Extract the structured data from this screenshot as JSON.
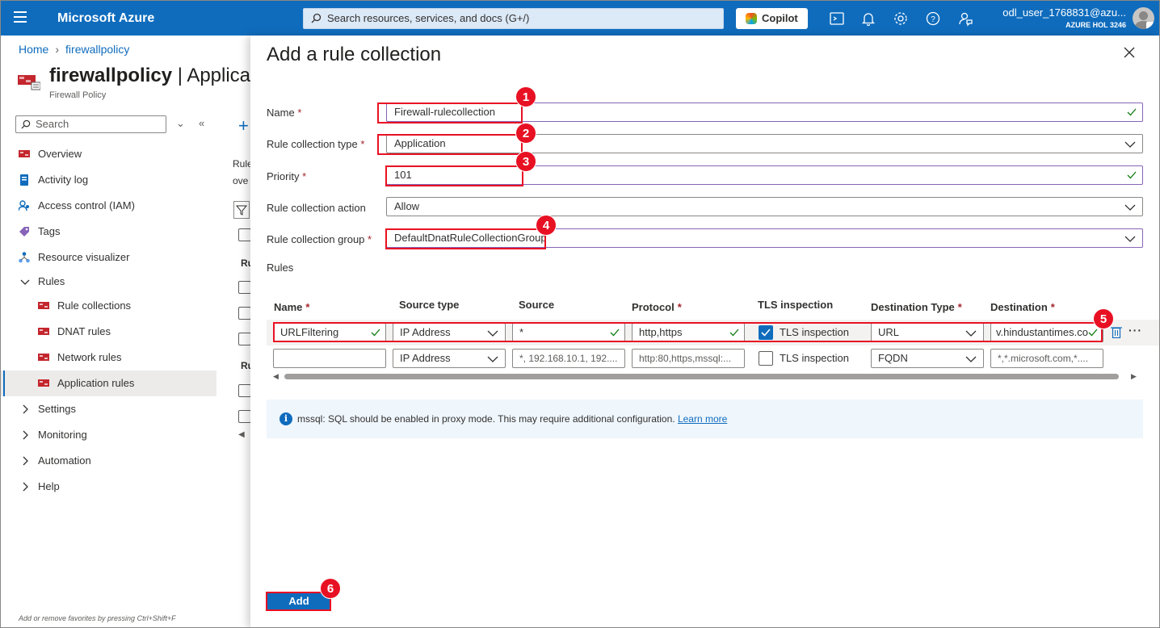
{
  "topbar": {
    "brand": "Microsoft Azure",
    "search_placeholder": "Search resources, services, and docs (G+/)",
    "copilot_label": "Copilot",
    "user_name": "odl_user_1768831@azu...",
    "tenant": "AZURE HOL 3246"
  },
  "breadcrumb": {
    "home": "Home",
    "resource": "firewallpolicy"
  },
  "resource": {
    "title": "firewallpolicy",
    "title_suffix": "| Applicat",
    "type": "Firewall Policy"
  },
  "sidebar": {
    "search_placeholder": "Search",
    "items": [
      {
        "label": "Overview",
        "icon": "firewall-icon"
      },
      {
        "label": "Activity log",
        "icon": "log-icon"
      },
      {
        "label": "Access control (IAM)",
        "icon": "iam-icon"
      },
      {
        "label": "Tags",
        "icon": "tag-icon"
      },
      {
        "label": "Resource visualizer",
        "icon": "visualizer-icon"
      },
      {
        "label": "Rules",
        "icon": "chevron-down-icon"
      },
      {
        "label": "Rule collections",
        "icon": "firewall-icon"
      },
      {
        "label": "DNAT rules",
        "icon": "firewall-icon"
      },
      {
        "label": "Network rules",
        "icon": "firewall-icon"
      },
      {
        "label": "Application rules",
        "icon": "firewall-icon"
      },
      {
        "label": "Settings",
        "icon": "chevron-right-icon"
      },
      {
        "label": "Monitoring",
        "icon": "chevron-right-icon"
      },
      {
        "label": "Automation",
        "icon": "chevron-right-icon"
      },
      {
        "label": "Help",
        "icon": "chevron-right-icon"
      }
    ],
    "favorites_hint": "Add or remove favorites by pressing Ctrl+Shift+F"
  },
  "middle": {
    "text1": "Rule",
    "text2": "ove",
    "hdr1": "Ru",
    "hdr2": "Ru"
  },
  "panel": {
    "title": "Add a rule collection",
    "fields": {
      "name_label": "Name",
      "name_value": "Firewall-rulecollection",
      "type_label": "Rule collection type",
      "type_value": "Application",
      "priority_label": "Priority",
      "priority_value": "101",
      "action_label": "Rule collection action",
      "action_value": "Allow",
      "group_label": "Rule collection group",
      "group_value": "DefaultDnatRuleCollectionGroup"
    },
    "rules_label": "Rules",
    "columns": [
      "Name",
      "Source type",
      "Source",
      "Protocol",
      "TLS inspection",
      "Destination Type",
      "Destination"
    ],
    "row1": {
      "name": "URLFiltering",
      "source_type": "IP Address",
      "source": "*",
      "protocol": "http,https",
      "tls": "TLS inspection",
      "dest_type": "URL",
      "destination": "v.hindustantimes.co"
    },
    "row2": {
      "name": "",
      "source_type": "IP Address",
      "source_ph": "*, 192.168.10.1, 192....",
      "protocol_ph": "http:80,https,mssql:...",
      "tls": "TLS inspection",
      "dest_type": "FQDN",
      "destination_ph": "*,*.microsoft.com,*...."
    },
    "info_text": "mssql: SQL should be enabled in proxy mode. This may require additional configuration.",
    "info_link": "Learn more",
    "add_button": "Add"
  },
  "annotations": [
    "1",
    "2",
    "3",
    "4",
    "5",
    "6"
  ],
  "colors": {
    "accent": "#0f6cbd",
    "highlight": "#e81123"
  }
}
